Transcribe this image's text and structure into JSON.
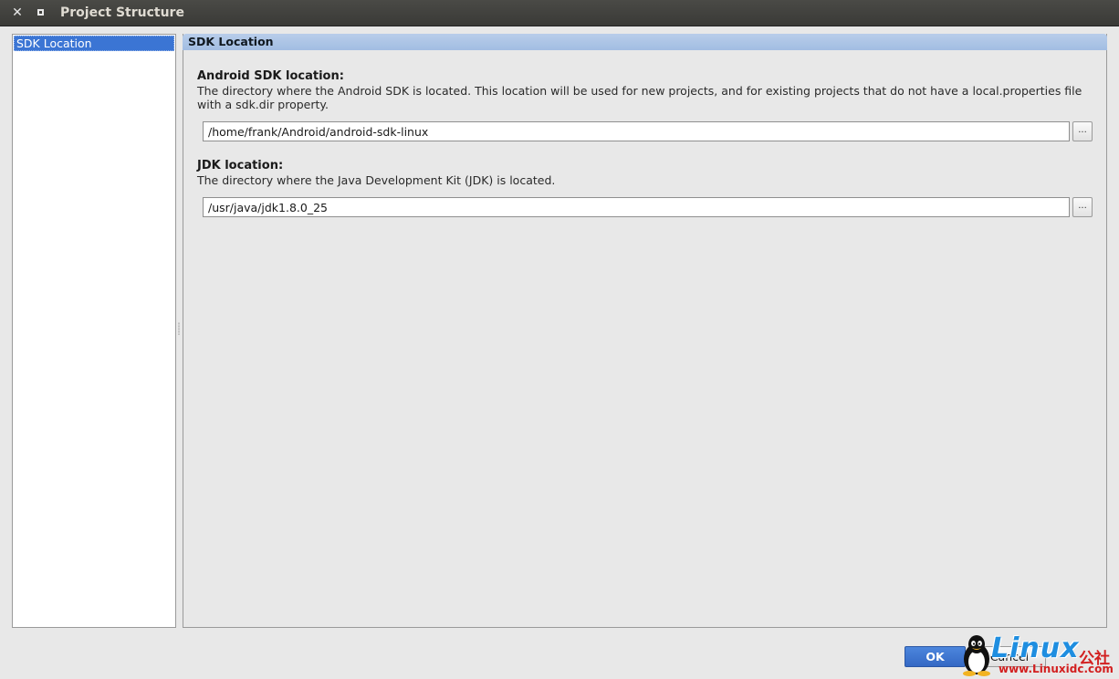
{
  "window": {
    "title": "Project Structure",
    "close_glyph": "✕",
    "controls": [
      "close-icon",
      "maximize-icon"
    ]
  },
  "sidebar": {
    "items": [
      {
        "label": "SDK Location",
        "selected": true
      }
    ]
  },
  "main": {
    "header": "SDK Location",
    "android_sdk": {
      "title": "Android SDK location:",
      "description": "The directory where the Android SDK is located. This location will be used for new projects, and for existing projects that do not have a local.properties file with a sdk.dir property.",
      "value": "/home/frank/Android/android-sdk-linux",
      "browse_label": "..."
    },
    "jdk": {
      "title": "JDK location:",
      "description": "The directory where the Java Development Kit (JDK) is located.",
      "value": "/usr/java/jdk1.8.0_25",
      "browse_label": "..."
    }
  },
  "footer": {
    "ok_label": "OK",
    "cancel_label": "Cancel"
  },
  "watermark": {
    "brand": "Linux",
    "brand_cn": "公社",
    "url": "www.Linuxidc.com"
  },
  "colors": {
    "selection": "#3b75d4",
    "header_bg": "#a8c0e4",
    "primary_button": "#3a72cf",
    "titlebar": "#3c3b37",
    "watermark_blue": "#1f8ee0",
    "watermark_red": "#d22020"
  }
}
